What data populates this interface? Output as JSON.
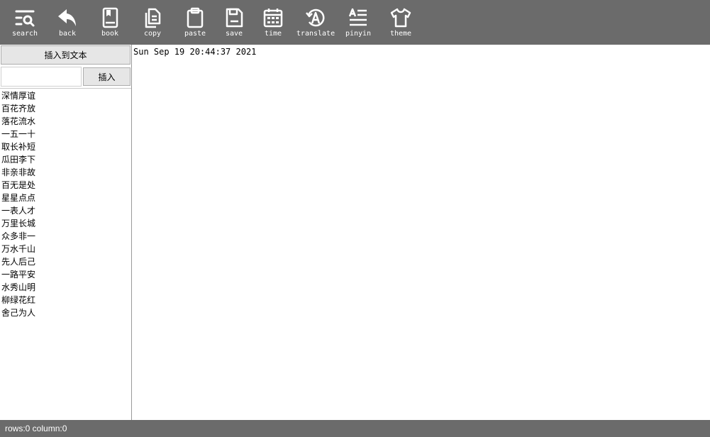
{
  "toolbar": {
    "items": [
      {
        "label": "search",
        "icon": "search-icon"
      },
      {
        "label": "back",
        "icon": "back-arrow-icon"
      },
      {
        "label": "book",
        "icon": "book-icon"
      },
      {
        "label": "copy",
        "icon": "copy-icon"
      },
      {
        "label": "paste",
        "icon": "paste-icon"
      },
      {
        "label": "save",
        "icon": "save-icon"
      },
      {
        "label": "time",
        "icon": "calendar-icon"
      },
      {
        "label": "translate",
        "icon": "translate-icon"
      },
      {
        "label": "pinyin",
        "icon": "pinyin-icon"
      },
      {
        "label": "theme",
        "icon": "shirt-icon"
      }
    ]
  },
  "sidebar": {
    "insert_to_text_label": "插入到文本",
    "input_value": "",
    "insert_button_label": "插入",
    "words": [
      "深情厚谊",
      "百花齐放",
      "落花流水",
      "一五一十",
      "取长补短",
      "瓜田李下",
      "非亲非故",
      "百无是处",
      "星星点点",
      "一表人才",
      "万里长城",
      "众多非一",
      "万水千山",
      "先人后己",
      "一路平安",
      "水秀山明",
      "柳绿花红",
      "舍己为人"
    ]
  },
  "editor": {
    "content": "Sun Sep 19 20:44:37 2021"
  },
  "status": {
    "text": "rows:0 column:0"
  },
  "colors": {
    "toolbar_bg": "#6b6b6b",
    "button_bg": "#e6e6e6",
    "text_white": "#ffffff"
  }
}
